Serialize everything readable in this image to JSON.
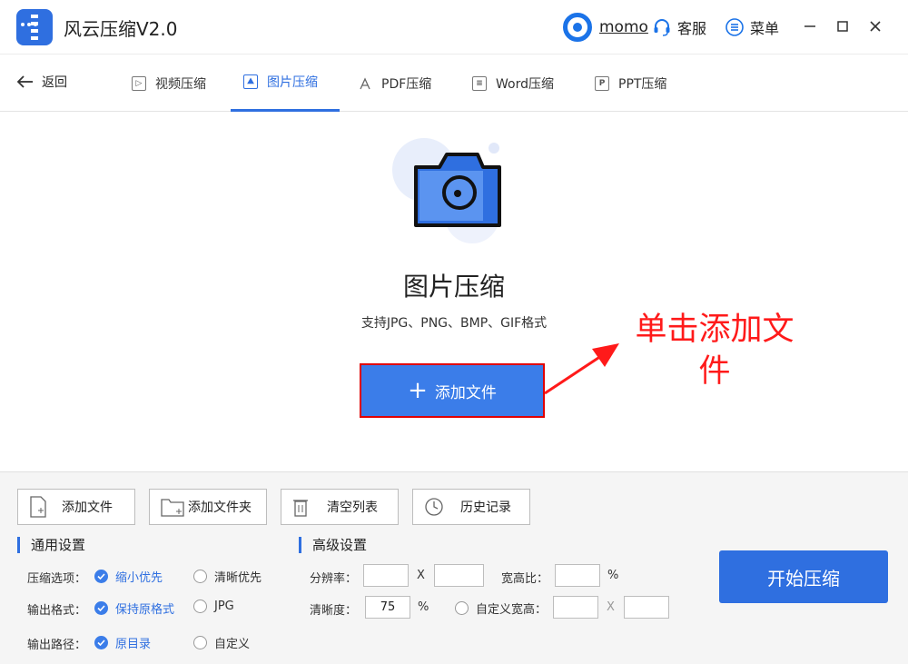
{
  "app": {
    "title": "风云压缩V2.0"
  },
  "header": {
    "username": "momo",
    "service_label": "客服",
    "menu_label": "菜单"
  },
  "nav": {
    "back_label": "返回",
    "tabs": [
      {
        "label": "视频压缩",
        "icon": "play-icon",
        "active": false
      },
      {
        "label": "图片压缩",
        "icon": "image-icon",
        "active": true
      },
      {
        "label": "PDF压缩",
        "icon": "pdf-icon",
        "active": false
      },
      {
        "label": "Word压缩",
        "icon": "document-icon",
        "active": false
      },
      {
        "label": "PPT压缩",
        "icon": "ppt-icon",
        "active": false
      }
    ]
  },
  "main": {
    "title": "图片压缩",
    "subtitle": "支持JPG、PNG、BMP、GIF格式",
    "add_file_label": "添加文件",
    "annotation": "单击添加文件"
  },
  "toolbar": {
    "add_file": "添加文件",
    "add_folder": "添加文件夹",
    "clear_list": "清空列表",
    "history": "历史记录"
  },
  "general": {
    "title": "通用设置",
    "compress_label": "压缩选项：",
    "compress_options": [
      "缩小优先",
      "清晰优先"
    ],
    "compress_selected": "缩小优先",
    "format_label": "输出格式：",
    "format_options": [
      "保持原格式",
      "JPG"
    ],
    "format_selected": "保持原格式",
    "path_label": "输出路径：",
    "path_options": [
      "原目录",
      "自定义"
    ],
    "path_selected": "原目录"
  },
  "advanced": {
    "title": "高级设置",
    "resolution_label": "分辨率：",
    "x_label": "X",
    "ratio_label": "宽高比：",
    "percent": "%",
    "clarity_label": "清晰度：",
    "clarity_value": "75",
    "custom_size_label": "自定义宽高："
  },
  "actions": {
    "start_label": "开始压缩"
  },
  "colors": {
    "accent": "#2f6fe0",
    "annotation": "#ff1a1a"
  }
}
